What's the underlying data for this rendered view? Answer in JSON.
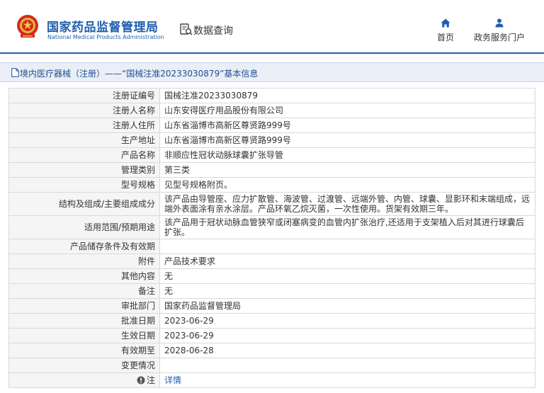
{
  "header": {
    "org_cn": "国家药品监督管理局",
    "org_en": "National Medical Products Administration",
    "section_title": "数据查询",
    "nav": [
      {
        "label": "首页",
        "icon": "home-icon"
      },
      {
        "label": "政务服务门户",
        "icon": "user-icon"
      }
    ]
  },
  "breadcrumb": {
    "text": "境内医疗器械（注册）——“国械注准20233030879”基本信息"
  },
  "colors": {
    "brand_blue": "#1f5fad",
    "label_bg": "#f5f5f5",
    "crumb_bg": "#e9eef7"
  },
  "rows": [
    {
      "label": "注册证编号",
      "value": "国械注准20233030879"
    },
    {
      "label": "注册人名称",
      "value": "山东安得医疗用品股份有限公司"
    },
    {
      "label": "注册人住所",
      "value": "山东省淄博市高新区尊贤路999号"
    },
    {
      "label": "生产地址",
      "value": "山东省淄博市高新区尊贤路999号"
    },
    {
      "label": "产品名称",
      "value": "非顺应性冠状动脉球囊扩张导管"
    },
    {
      "label": "管理类别",
      "value": "第三类"
    },
    {
      "label": "型号规格",
      "value": "见型号规格附页。"
    },
    {
      "label": "结构及组成/主要组成成分",
      "value": "该产品由导管座、应力扩散管、海波管、过渡管、远端外管、内管、球囊、显影环和末端组成，远端外表面涂有亲水涂层。产品环氧乙烷灭菌，一次性使用。货架有效期三年。"
    },
    {
      "label": "适用范围/预期用途",
      "value": "该产品用于冠状动脉血管狭窄或闭塞病变的血管内扩张治疗,还适用于支架植入后对其进行球囊后扩张。"
    },
    {
      "label": "产品储存条件及有效期",
      "value": ""
    },
    {
      "label": "附件",
      "value": "产品技术要求"
    },
    {
      "label": "其他内容",
      "value": "无"
    },
    {
      "label": "备注",
      "value": "无"
    },
    {
      "label": "审批部门",
      "value": "国家药品监督管理局"
    },
    {
      "label": "批准日期",
      "value": "2023-06-29"
    },
    {
      "label": "生效日期",
      "value": "2023-06-29"
    },
    {
      "label": "有效期至",
      "value": "2028-06-28"
    },
    {
      "label": "变更情况",
      "value": ""
    }
  ],
  "note_row": {
    "label": "注",
    "link": "详情"
  }
}
